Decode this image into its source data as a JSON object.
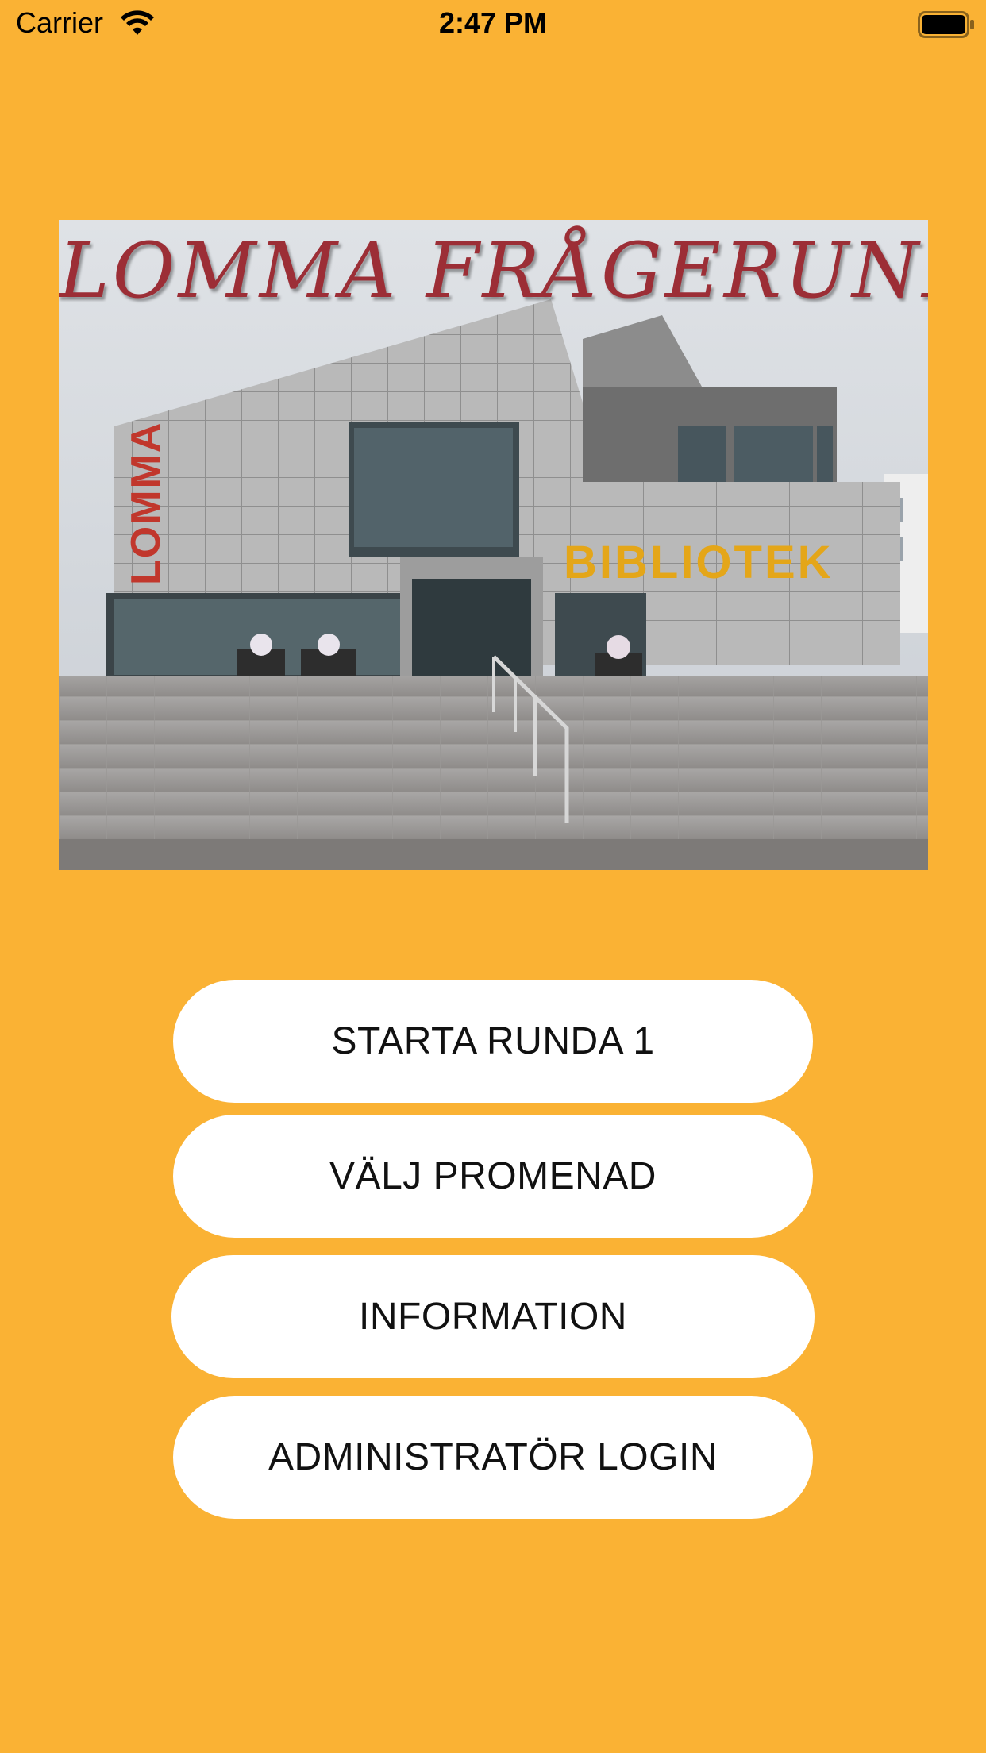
{
  "status_bar": {
    "carrier": "Carrier",
    "time": "2:47 PM",
    "wifi_icon": "wifi-icon",
    "battery_icon": "battery-icon"
  },
  "hero": {
    "title": "LOMMA  FRÅGERUNDA",
    "sign_vertical": "LOMMA",
    "sign_building": "BIBLIOTEK"
  },
  "menu": {
    "buttons": [
      {
        "label": "STARTA RUNDA 1"
      },
      {
        "label": "VÄLJ PROMENAD"
      },
      {
        "label": "INFORMATION"
      },
      {
        "label": "ADMINISTRATÖR LOGIN"
      }
    ]
  },
  "colors": {
    "background": "#FAB234",
    "button_bg": "#FFFFFF",
    "button_text": "#111111",
    "title_text": "#9C2E36"
  }
}
